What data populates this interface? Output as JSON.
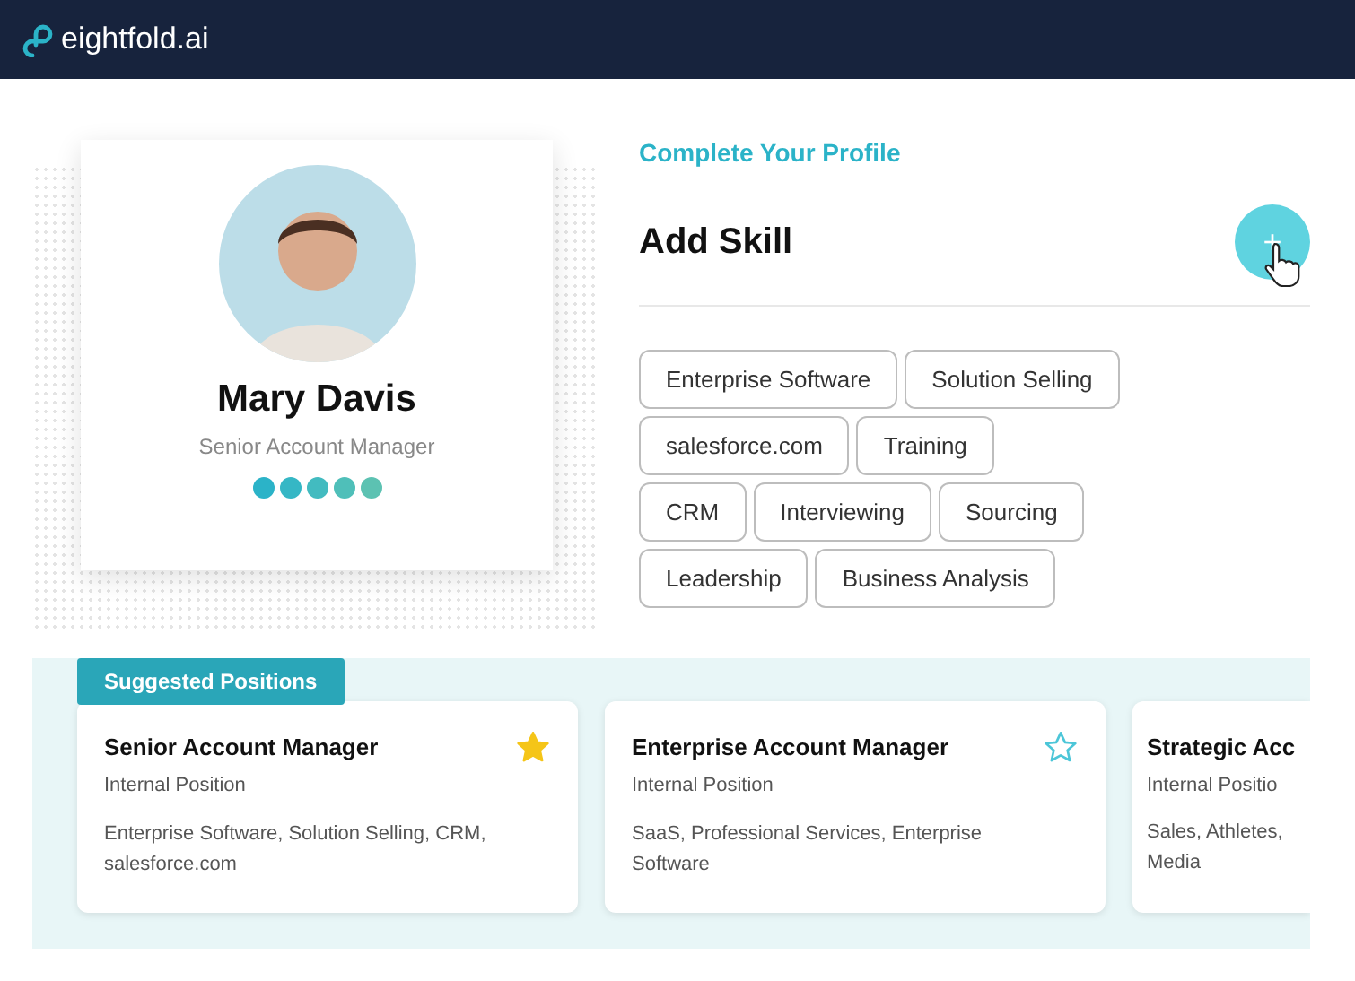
{
  "header": {
    "logo": "eightfold.ai"
  },
  "profile": {
    "name": "Mary Davis",
    "title": "Senior Account Manager",
    "dots": [
      {
        "color": "#2bb3c8"
      },
      {
        "color": "#35b7c5"
      },
      {
        "color": "#42bbc0"
      },
      {
        "color": "#4fbfb9"
      },
      {
        "color": "#5cc2b2"
      }
    ]
  },
  "section_label": "Complete Your Profile",
  "heading": "Add Skill",
  "add_button": "+",
  "skills": [
    [
      "Enterprise Software",
      "Solution Selling"
    ],
    [
      "salesforce.com",
      "Training"
    ],
    [
      "CRM",
      "Interviewing",
      "Sourcing"
    ],
    [
      "Leadership",
      "Business Analysis"
    ]
  ],
  "suggested": {
    "label": "Suggested Positions",
    "positions": [
      {
        "title": "Senior Account Manager",
        "type": "Internal Position",
        "skills": "Enterprise Software, Solution Selling, CRM, salesforce.com",
        "favorite": true
      },
      {
        "title": "Enterprise Account Manager",
        "type": "Internal Position",
        "skills": "SaaS, Professional Services, Enterprise Software",
        "favorite": false
      },
      {
        "title": "Strategic Acc",
        "type": "Internal Positio",
        "skills": "Sales, Athletes, Media"
      }
    ]
  }
}
